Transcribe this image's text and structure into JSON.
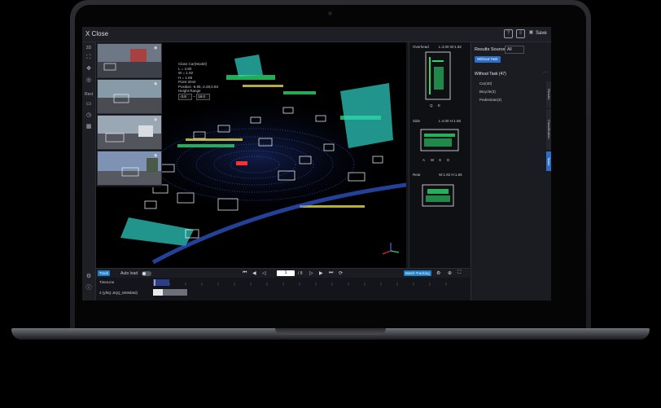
{
  "app": {
    "close_label": "X Close",
    "save_label": "Save"
  },
  "tools": [
    "3D",
    "Rect"
  ],
  "info_panel": {
    "class_line": "Class  Car(Model)",
    "lines": [
      "L = 4.80",
      "W = 1.92",
      "H = 1.65",
      "Point  2044",
      "Position  -6.95,-2.28,0.93"
    ],
    "height_range_label": "Height Range",
    "height_min": "-3.8",
    "height_max": "19.0"
  },
  "side_views": {
    "overhead": {
      "title": "Overhead",
      "dims": "L:4.00  W:1.92"
    },
    "side": {
      "title": "Side",
      "dims": "L:4.00  H:1.65"
    },
    "rear": {
      "title": "Rear",
      "dims": "W:1.92  H:1.65"
    },
    "controls_overhead": [
      "Q",
      "E"
    ],
    "controls_side": [
      "A",
      "W",
      "S",
      "D"
    ],
    "controls_rear": [
      "A",
      "W",
      "S",
      "D"
    ]
  },
  "results_panel": {
    "title": "Results Source",
    "source_value": "All",
    "active_filter": "Without Task",
    "group_label": "Without Task (47)",
    "classes": [
      "Car(40)",
      "Bicycle(3)",
      "Pedestrian(3)"
    ],
    "vertical_tabs": [
      "Results",
      "Classification",
      "Tasks"
    ]
  },
  "playbar": {
    "track_button": "Track",
    "auto_load_label": "Auto load",
    "frame_value": "1",
    "frame_total": "/ 8",
    "right_button": "Batch Tracking"
  },
  "timeline": {
    "label": "TimeLine",
    "track_name": "3 (yfkQ JKjQ_W8Nb6d)"
  },
  "colors": {
    "accent": "#1f7ec9",
    "lidar_blue": "#3a6cff",
    "lidar_green": "#2bd96b",
    "box_white": "#ffffff"
  },
  "icons": [
    "close-icon",
    "comment-icon",
    "export-icon",
    "save-icon",
    "move-icon",
    "eye-icon",
    "play-icon",
    "settings-icon"
  ]
}
